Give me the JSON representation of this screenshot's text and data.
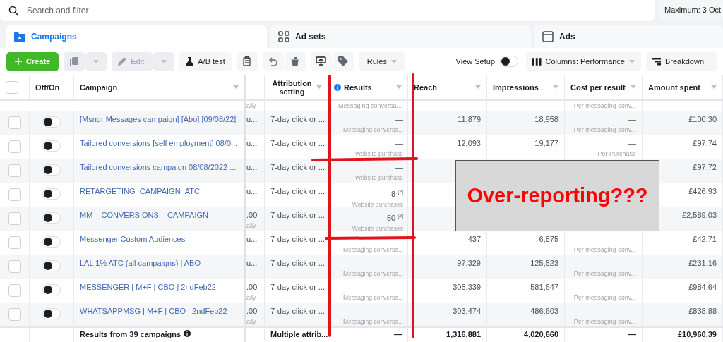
{
  "search": {
    "placeholder": "Search and filter"
  },
  "date_button": "Maximum: 3 Oct",
  "tabs": [
    {
      "label": "Campaigns",
      "selected": true
    },
    {
      "label": "Ad sets",
      "selected": false
    },
    {
      "label": "Ads",
      "selected": false
    }
  ],
  "toolbar": {
    "create": "Create",
    "edit": {
      "label": "Edit",
      "disabled": true
    },
    "ab_test": "A/B test",
    "rules": "Rules",
    "view_setup": {
      "label": "View Setup",
      "on": false
    },
    "columns": "Columns: Performance",
    "breakdown": "Breakdown"
  },
  "table": {
    "all_selected": false,
    "columns": [
      {
        "label": "Off/On"
      },
      {
        "label": "Campaign"
      },
      {
        "label": "Attribution setting"
      },
      {
        "label": "Results"
      },
      {
        "label": "Reach"
      },
      {
        "label": "Impressions"
      },
      {
        "label": "Cost per result"
      },
      {
        "label": "Amount spent"
      }
    ],
    "partial_row": {
      "budget_note": "aily",
      "result_type": "Messaging conversa...",
      "cost_type": "Per messaging conv..."
    },
    "rows": [
      {
        "checked": false,
        "on": false,
        "name": "[Msngr Messages campaign] [Abo] [09/08/22]",
        "budget": "u...",
        "attribution": "7-day click or ...",
        "result": "—",
        "result_type": "Messaging conversa...",
        "reach": "11,879",
        "impressions": "18,958",
        "cost": "—",
        "cost_type": "Per messaging conv...",
        "amount": "£100.30"
      },
      {
        "checked": false,
        "on": false,
        "name": "Tailored conversions [self employment] 08/0...",
        "budget": "u...",
        "attribution": "7-day click or ...",
        "result": "—",
        "result_type": "Website purchase",
        "reach": "12,093",
        "impressions": "19,177",
        "cost": "—",
        "cost_type": "Per Purchase",
        "amount": "£97.74"
      },
      {
        "checked": false,
        "on": false,
        "name": "Tailored conversions campaign 08/08/2022 ...",
        "budget": "u...",
        "attribution": "7-day click or ...",
        "result": "—",
        "result_type": "Website purchase",
        "amount": "£97.72"
      },
      {
        "checked": false,
        "on": false,
        "name": "RETARGETING_CAMPAIGN_ATC",
        "budget": "u...",
        "attribution": "7-day click or ...",
        "result": "8 $^{[2]}$",
        "result_type": "Website purchases",
        "amount": "£426.93"
      },
      {
        "checked": false,
        "on": false,
        "name": "MM__CONVERSIONS__CAMPAIGN",
        "budget": ".00",
        "budget_note": "aily",
        "attribution": "7-day click or ...",
        "result": "50 $^{[2]}$",
        "result_type": "Website purchases",
        "amount": "£2,589.03"
      },
      {
        "checked": false,
        "on": false,
        "name": "Messenger Custom Audiences",
        "budget": "u...",
        "attribution": "7-day click or ...",
        "result_type": "Messaging conversa...",
        "reach": "437",
        "impressions": "6,875",
        "cost": "—",
        "cost_type": "Per messaging conv...",
        "amount": "£42.71"
      },
      {
        "checked": false,
        "on": false,
        "name": "LAL 1% ATC (all campaigns) | ABO",
        "budget": "u...",
        "attribution": "7-day click or ...",
        "result": "—",
        "result_type": "Messaging conversa...",
        "reach": "97,329",
        "impressions": "125,523",
        "cost": "—",
        "cost_type": "Per messaging conv...",
        "amount": "£231.16"
      },
      {
        "checked": false,
        "on": false,
        "name": "MESSENGER | M+F | CBO | 2ndFeb22",
        "budget": ".00",
        "budget_note": "aily",
        "attribution": "7-day click or ...",
        "result": "—",
        "result_type": "Messaging conversa...",
        "reach": "305,339",
        "impressions": "581,647",
        "cost": "—",
        "cost_type": "Per messaging conv...",
        "amount": "£984.64"
      },
      {
        "checked": false,
        "on": false,
        "name": "WHATSAPPMSG | M+F | CBO | 2ndFeb22",
        "budget": ".00",
        "budget_note": "aily",
        "attribution": "7-day click or ...",
        "result": "—",
        "result_type": "Messaging conversa...",
        "reach": "303,474",
        "impressions": "486,603",
        "cost": "—",
        "cost_type": "Per messaging conv...",
        "amount": "£838.88"
      }
    ],
    "footer": {
      "label": "Results from 39 campaigns",
      "attribution": "Multiple attrib...",
      "result": "—",
      "reach": "1,316,881",
      "impressions": "4,020,660",
      "cost": "—",
      "amount": "£10,960.39"
    }
  },
  "annotation": {
    "text": "Over-reporting???"
  }
}
